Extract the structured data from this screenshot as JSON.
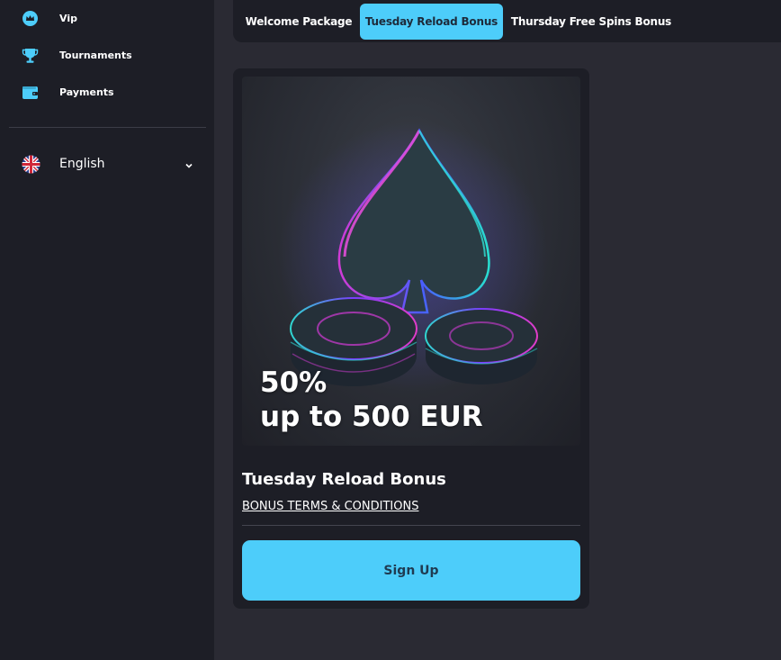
{
  "sidebar": {
    "items": [
      {
        "label": "Vip",
        "icon": "crown-icon"
      },
      {
        "label": "Tournaments",
        "icon": "trophy-icon"
      },
      {
        "label": "Payments",
        "icon": "wallet-icon"
      }
    ],
    "language": {
      "label": "English",
      "icon": "uk-flag-icon"
    }
  },
  "tabs": [
    {
      "label": "Welcome Package",
      "active": false
    },
    {
      "label": "Tuesday Reload Bonus",
      "active": true
    },
    {
      "label": "Thursday Free Spins Bonus",
      "active": false
    }
  ],
  "bonus_card": {
    "headline_percent": "50%",
    "headline_amount": "up to 500 EUR",
    "title": "Tuesday Reload Bonus",
    "terms_link": "BONUS TERMS & CONDITIONS",
    "cta_label": "Sign Up"
  },
  "colors": {
    "accent": "#4dcdfa",
    "sidebar_bg": "#1d1e26",
    "page_bg": "#2a2a33"
  }
}
